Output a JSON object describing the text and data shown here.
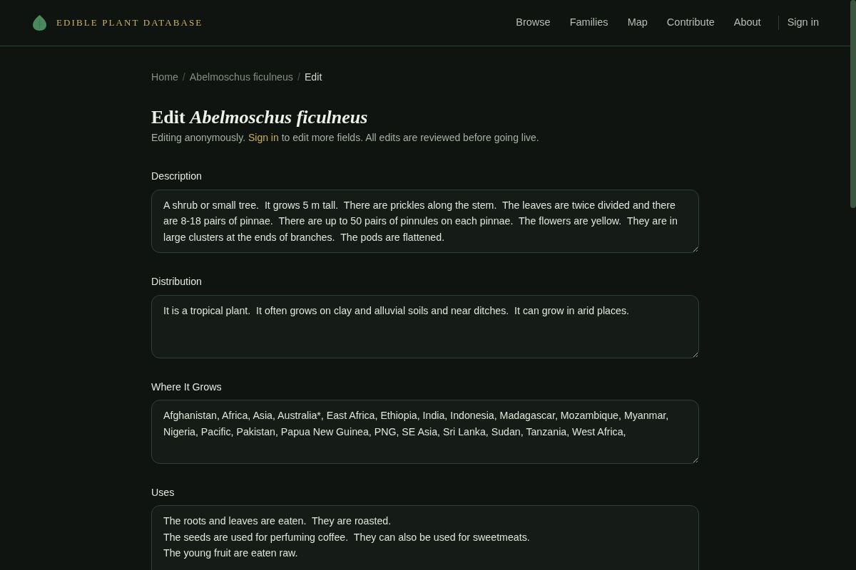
{
  "header": {
    "brand": "EDIBLE PLANT DATABASE",
    "nav": [
      {
        "label": "Browse",
        "kind": "link"
      },
      {
        "label": "Families",
        "kind": "link"
      },
      {
        "label": "Map",
        "kind": "link"
      },
      {
        "label": "Contribute",
        "kind": "link"
      },
      {
        "label": "About",
        "kind": "link"
      },
      {
        "label": "Sign in",
        "kind": "account"
      }
    ]
  },
  "breadcrumb": {
    "separator": "/",
    "items": [
      {
        "label": "Home",
        "selected": false
      },
      {
        "label": "Abelmoschus ficulneus",
        "selected": false
      },
      {
        "label": "Edit",
        "selected": true
      }
    ]
  },
  "title": "Edit *Abelmoschus ficulneus*",
  "subtitle": {
    "before": "Editing anonymously.",
    "link": "Sign in",
    "after": "to edit more fields. All edits are reviewed before going live."
  },
  "fields": [
    {
      "label": "Description",
      "value": "A shrub or small tree.  It grows 5 m tall.  There are prickles along the stem.  The leaves are twice divided and there are 8-18 pairs of pinnae.  There are up to 50 pairs of pinnules on each pinnae.  The flowers are yellow.  They are in large clusters at the ends of branches.  The pods are flattened."
    },
    {
      "label": "Distribution",
      "value": "It is a tropical plant.  It often grows on clay and alluvial soils and near ditches.  It can grow in arid places."
    },
    {
      "label": "Where It Grows",
      "value": "Afghanistan, Africa, Asia, Australia*, East Africa, Ethiopia, India, Indonesia, Madagascar, Mozambique, Myanmar, Nigeria, Pacific, Pakistan, Papua New Guinea, PNG, SE Asia, Sri Lanka, Sudan, Tanzania, West Africa,"
    },
    {
      "label": "Uses",
      "value": "The roots and leaves are eaten.  They are roasted.\nThe seeds are used for perfuming coffee.  They can also be used for sweetmeats.\nThe young fruit are eaten raw."
    }
  ]
}
